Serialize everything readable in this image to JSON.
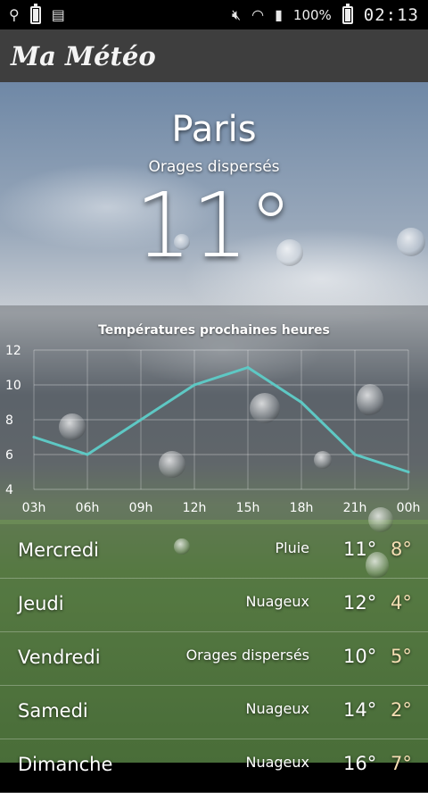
{
  "status_bar": {
    "battery_percent": "100%",
    "time": "02:13",
    "left_icons": [
      "usb-icon",
      "battery-full-icon",
      "sim-disabled-icon"
    ],
    "right_icons": [
      "mute-icon",
      "wifi-icon",
      "signal-icon"
    ]
  },
  "app": {
    "title": "Ma Météo"
  },
  "current": {
    "city": "Paris",
    "condition": "Orages dispersés",
    "temperature": "11°"
  },
  "chart_data": {
    "type": "line",
    "title": "Températures prochaines heures",
    "x": [
      "03h",
      "06h",
      "09h",
      "12h",
      "15h",
      "18h",
      "21h",
      "00h"
    ],
    "series": [
      {
        "values": [
          7,
          6,
          8,
          10,
          11,
          9,
          6,
          5
        ]
      }
    ],
    "ylim": [
      4,
      12
    ],
    "yticks": [
      "4",
      "6",
      "8",
      "10",
      "12"
    ],
    "grid": true,
    "color": "#5ec8c4"
  },
  "forecast": [
    {
      "day": "Mercredi",
      "desc": "Pluie",
      "hi": "11°",
      "lo": "8°"
    },
    {
      "day": "Jeudi",
      "desc": "Nuageux",
      "hi": "12°",
      "lo": "4°"
    },
    {
      "day": "Vendredi",
      "desc": "Orages dispersés",
      "hi": "10°",
      "lo": "5°"
    },
    {
      "day": "Samedi",
      "desc": "Nuageux",
      "hi": "14°",
      "lo": "2°"
    },
    {
      "day": "Dimanche",
      "desc": "Nuageux",
      "hi": "16°",
      "lo": "7°"
    }
  ]
}
